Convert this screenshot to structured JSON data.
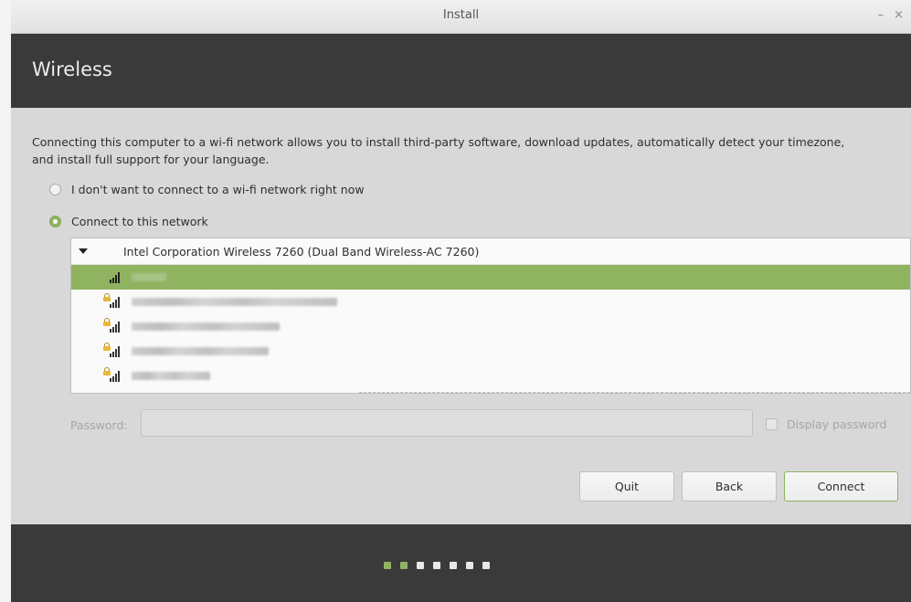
{
  "window": {
    "title": "Install",
    "minimize_glyph": "–",
    "close_glyph": "×"
  },
  "page": {
    "heading": "Wireless",
    "intro": "Connecting this computer to a wi-fi network allows you to install third-party software, download updates, automatically detect your timezone, and install full support for your language."
  },
  "options": {
    "no_wifi_label": "I don't want to connect to a wi-fi network right now",
    "connect_label": "Connect to this network",
    "selected": "connect"
  },
  "network_list": {
    "adapter": "Intel Corporation Wireless 7260 (Dual Band Wireless-AC 7260)",
    "networks": [
      {
        "secured": false,
        "selected": true,
        "ssid_obscured": true
      },
      {
        "secured": true,
        "selected": false,
        "ssid_obscured": true
      },
      {
        "secured": true,
        "selected": false,
        "ssid_obscured": true
      },
      {
        "secured": true,
        "selected": false,
        "ssid_obscured": true
      },
      {
        "secured": true,
        "selected": false,
        "ssid_obscured": true
      }
    ]
  },
  "password": {
    "label": "Password:",
    "value": "",
    "display_label": "Display password",
    "display_checked": false,
    "enabled": false
  },
  "buttons": {
    "quit": "Quit",
    "back": "Back",
    "connect": "Connect"
  },
  "progress": {
    "total_steps": 7,
    "completed_steps": 2
  },
  "colors": {
    "accent": "#8fb360",
    "header_bg": "#3a3a3a",
    "content_bg": "#d8d8d8"
  },
  "icons": {
    "signal": "wifi-signal-icon",
    "lock": "lock-icon",
    "expander": "triangle-down-icon"
  }
}
